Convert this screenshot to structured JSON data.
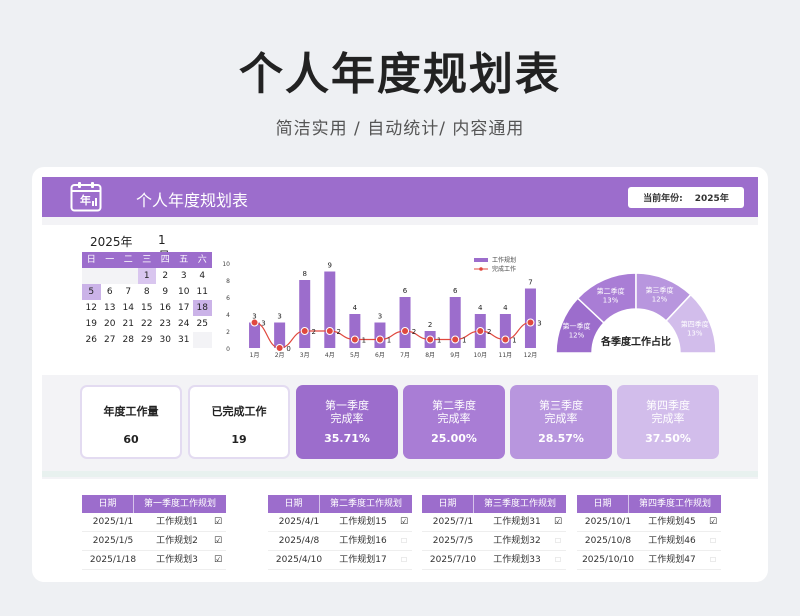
{
  "page": {
    "title": "个人年度规划表",
    "subtitle": "简洁实用 / 自动统计/ 内容通用"
  },
  "banner": {
    "icon_char": "年",
    "title": "个人年度规划表",
    "year_label": "当前年份:",
    "year_value": "2025年"
  },
  "calendar": {
    "year": "2025年",
    "month": "1月",
    "weekdays": [
      "日",
      "一",
      "二",
      "三",
      "四",
      "五",
      "六"
    ],
    "rows": [
      [
        "",
        "",
        "",
        "1",
        "2",
        "3",
        "4"
      ],
      [
        "5",
        "6",
        "7",
        "8",
        "9",
        "10",
        "11"
      ],
      [
        "12",
        "13",
        "14",
        "15",
        "16",
        "17",
        "18"
      ],
      [
        "19",
        "20",
        "21",
        "22",
        "23",
        "24",
        "25"
      ],
      [
        "26",
        "27",
        "28",
        "29",
        "30",
        "31",
        ""
      ]
    ],
    "highlighted": [
      "1",
      "5",
      "18"
    ]
  },
  "chart_data": [
    {
      "type": "bar",
      "categories": [
        "1月",
        "2月",
        "3月",
        "4月",
        "5月",
        "6月",
        "7月",
        "8月",
        "9月",
        "10月",
        "11月",
        "12月"
      ],
      "series": [
        {
          "name": "工作规划",
          "values": [
            3,
            3,
            8,
            9,
            4,
            3,
            6,
            2,
            6,
            4,
            4,
            7
          ],
          "color": "#9c6dcc"
        },
        {
          "name": "完成工作",
          "type": "line",
          "values": [
            3,
            0,
            2,
            2,
            1,
            1,
            2,
            1,
            1,
            2,
            1,
            3
          ],
          "color": "#e0483e"
        }
      ],
      "yticks": [
        0,
        2,
        4,
        6,
        8,
        10
      ],
      "ylim": [
        0,
        10
      ],
      "legend": "top-right"
    },
    {
      "type": "pie",
      "title": "各季度工作占比",
      "categories": [
        "第一季度",
        "第二季度",
        "第三季度",
        "第四季度"
      ],
      "values": [
        12,
        13,
        12,
        13
      ],
      "labels": [
        "12%",
        "13%",
        "12%",
        "13%"
      ],
      "colors": [
        "#9c6dcc",
        "#a97dd5",
        "#b896de",
        "#d2bdeb"
      ]
    }
  ],
  "kpis": {
    "total_label": "年度工作量",
    "total_value": "60",
    "done_label": "已完成工作",
    "done_value": "19",
    "quarters": [
      {
        "l1": "第一季度",
        "l2": "完成率",
        "pct": "35.71%",
        "color": "#9c6dcc"
      },
      {
        "l1": "第二季度",
        "l2": "完成率",
        "pct": "25.00%",
        "color": "#a97dd5"
      },
      {
        "l1": "第三季度",
        "l2": "完成率",
        "pct": "28.57%",
        "color": "#b896de"
      },
      {
        "l1": "第四季度",
        "l2": "完成率",
        "pct": "37.50%",
        "color": "#d2bdeb"
      }
    ]
  },
  "tables": [
    {
      "date_header": "日期",
      "plan_header": "第一季度工作规划",
      "rows": [
        {
          "date": "2025/1/1",
          "plan": "工作规划1",
          "done": true
        },
        {
          "date": "2025/1/5",
          "plan": "工作规划2",
          "done": true
        },
        {
          "date": "2025/1/18",
          "plan": "工作规划3",
          "done": true
        }
      ]
    },
    {
      "date_header": "日期",
      "plan_header": "第二季度工作规划",
      "rows": [
        {
          "date": "2025/4/1",
          "plan": "工作规划15",
          "done": true
        },
        {
          "date": "2025/4/8",
          "plan": "工作规划16",
          "done": false
        },
        {
          "date": "2025/4/10",
          "plan": "工作规划17",
          "done": false
        }
      ]
    },
    {
      "date_header": "日期",
      "plan_header": "第三季度工作规划",
      "rows": [
        {
          "date": "2025/7/1",
          "plan": "工作规划31",
          "done": true
        },
        {
          "date": "2025/7/5",
          "plan": "工作规划32",
          "done": false
        },
        {
          "date": "2025/7/10",
          "plan": "工作规划33",
          "done": false
        }
      ]
    },
    {
      "date_header": "日期",
      "plan_header": "第四季度工作规划",
      "rows": [
        {
          "date": "2025/10/1",
          "plan": "工作规划45",
          "done": true
        },
        {
          "date": "2025/10/8",
          "plan": "工作规划46",
          "done": false
        },
        {
          "date": "2025/10/10",
          "plan": "工作规划47",
          "done": false
        }
      ]
    }
  ],
  "checkbox": {
    "on": "☑",
    "off": "☐"
  }
}
